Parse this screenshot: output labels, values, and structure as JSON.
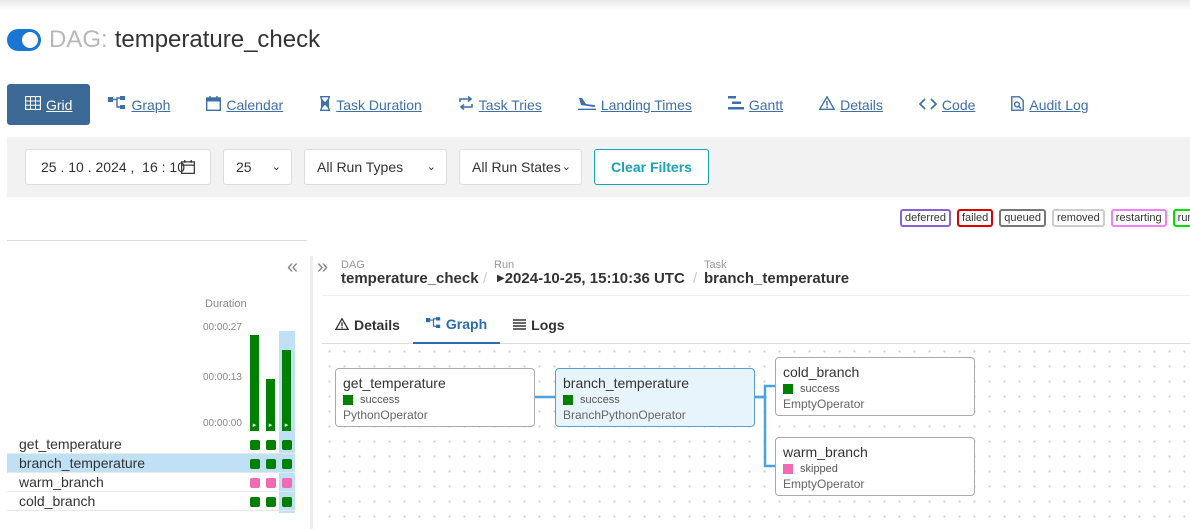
{
  "header": {
    "prefix": "DAG:",
    "dag_id": "temperature_check",
    "paused": false
  },
  "nav": [
    {
      "label": "Grid",
      "icon": "grid-icon"
    },
    {
      "label": "Graph",
      "icon": "graph-icon"
    },
    {
      "label": "Calendar",
      "icon": "calendar-icon"
    },
    {
      "label": "Task Duration",
      "icon": "hourglass-icon"
    },
    {
      "label": "Task Tries",
      "icon": "retry-icon"
    },
    {
      "label": "Landing Times",
      "icon": "plane-icon"
    },
    {
      "label": "Gantt",
      "icon": "gantt-icon"
    },
    {
      "label": "Details",
      "icon": "warning-icon"
    },
    {
      "label": "Code",
      "icon": "code-icon"
    },
    {
      "label": "Audit Log",
      "icon": "audit-icon"
    }
  ],
  "filters": {
    "date": "25 . 10 . 2024 ,  16 : 10",
    "num_runs": "25",
    "run_types": "All Run Types",
    "run_states": "All Run States",
    "clear": "Clear Filters"
  },
  "legend": [
    {
      "label": "deferred",
      "color": "#8a63d2"
    },
    {
      "label": "failed",
      "color": "#e00000"
    },
    {
      "label": "queued",
      "color": "#777777"
    },
    {
      "label": "removed",
      "color": "#cccccc"
    },
    {
      "label": "restarting",
      "color": "#ee82ee"
    },
    {
      "label": "run",
      "color": "#00e000"
    }
  ],
  "grid": {
    "duration_label": "Duration",
    "ticks": [
      "00:00:27",
      "00:00:13",
      "00:00:00"
    ],
    "run_durations_sec": [
      26,
      14,
      22
    ],
    "tasks": [
      {
        "name": "get_temperature",
        "states": [
          "success",
          "success",
          "success"
        ]
      },
      {
        "name": "branch_temperature",
        "states": [
          "success",
          "success",
          "success"
        ]
      },
      {
        "name": "warm_branch",
        "states": [
          "skipped",
          "skipped",
          "skipped"
        ]
      },
      {
        "name": "cold_branch",
        "states": [
          "success",
          "success",
          "success"
        ]
      }
    ]
  },
  "breadcrumb": {
    "dag_label": "DAG",
    "dag_value": "temperature_check",
    "run_label": "Run",
    "run_value": "2024-10-25, 15:10:36 UTC",
    "task_label": "Task",
    "task_value": "branch_temperature"
  },
  "subtabs": [
    {
      "label": "Details",
      "icon": "warning-icon"
    },
    {
      "label": "Graph",
      "icon": "graph-icon"
    },
    {
      "label": "Logs",
      "icon": "list-icon"
    }
  ],
  "graph_nodes": [
    {
      "name": "get_temperature",
      "state": "success",
      "operator": "PythonOperator"
    },
    {
      "name": "branch_temperature",
      "state": "success",
      "operator": "BranchPythonOperator"
    },
    {
      "name": "cold_branch",
      "state": "success",
      "operator": "EmptyOperator"
    },
    {
      "name": "warm_branch",
      "state": "skipped",
      "operator": "EmptyOperator"
    }
  ],
  "colors": {
    "success": "#008000",
    "skipped": "#f06ab4",
    "accent": "#3c6896"
  }
}
